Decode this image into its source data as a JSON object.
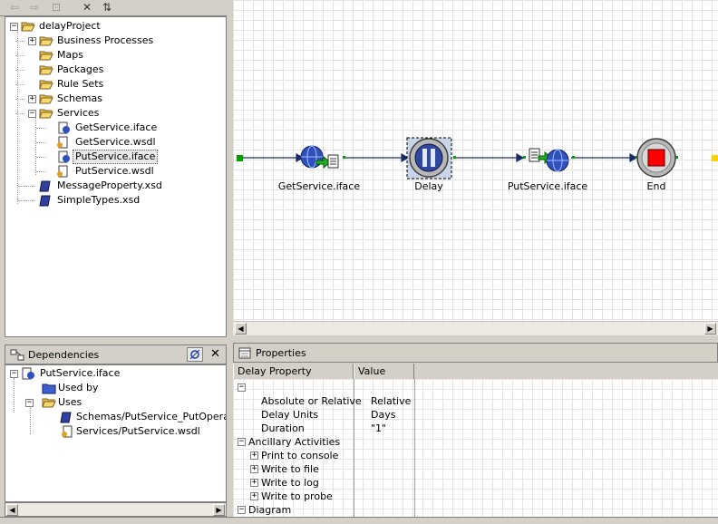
{
  "project_tree": {
    "root": "delayProject",
    "items": [
      {
        "label": "Business Processes",
        "expander": "+"
      },
      {
        "label": "Maps",
        "expander": ""
      },
      {
        "label": "Packages",
        "expander": ""
      },
      {
        "label": "Rule Sets",
        "expander": ""
      },
      {
        "label": "Schemas",
        "expander": "+"
      },
      {
        "label": "Services",
        "expander": "−"
      }
    ],
    "services_children": [
      "GetService.iface",
      "GetService.wsdl",
      "PutService.iface",
      "PutService.wsdl"
    ],
    "root_files": [
      "MessageProperty.xsd",
      "SimpleTypes.xsd"
    ],
    "selected": "PutService.iface"
  },
  "canvas": {
    "nodes": [
      {
        "label": "GetService.iface",
        "icon": "globe-doc-icon"
      },
      {
        "label": "Delay",
        "icon": "pause-icon"
      },
      {
        "label": "PutService.iface",
        "icon": "doc-globe-icon"
      },
      {
        "label": "End",
        "icon": "stop-icon"
      }
    ]
  },
  "dependencies": {
    "title": "Dependencies",
    "root": "PutService.iface",
    "used_by": "Used by",
    "uses": "Uses",
    "uses_children": [
      "Schemas/PutService_PutOperation",
      "Services/PutService.wsdl"
    ]
  },
  "properties": {
    "title": "Properties",
    "col_property": "Delay Property",
    "col_value": "Value",
    "rows": [
      {
        "name": "Absolute or Relative",
        "value": "Relative"
      },
      {
        "name": "Delay Units",
        "value": "Days"
      },
      {
        "name": "Duration",
        "value": "\"1\""
      }
    ],
    "ancillary": "Ancillary Activities",
    "ancillary_items": [
      "Print to console",
      "Write to file",
      "Write to log",
      "Write to probe"
    ],
    "diagram": "Diagram"
  },
  "colors": {
    "accent_green": "#00a000",
    "end_red": "#ff0000",
    "link": "#1a2a6a"
  }
}
